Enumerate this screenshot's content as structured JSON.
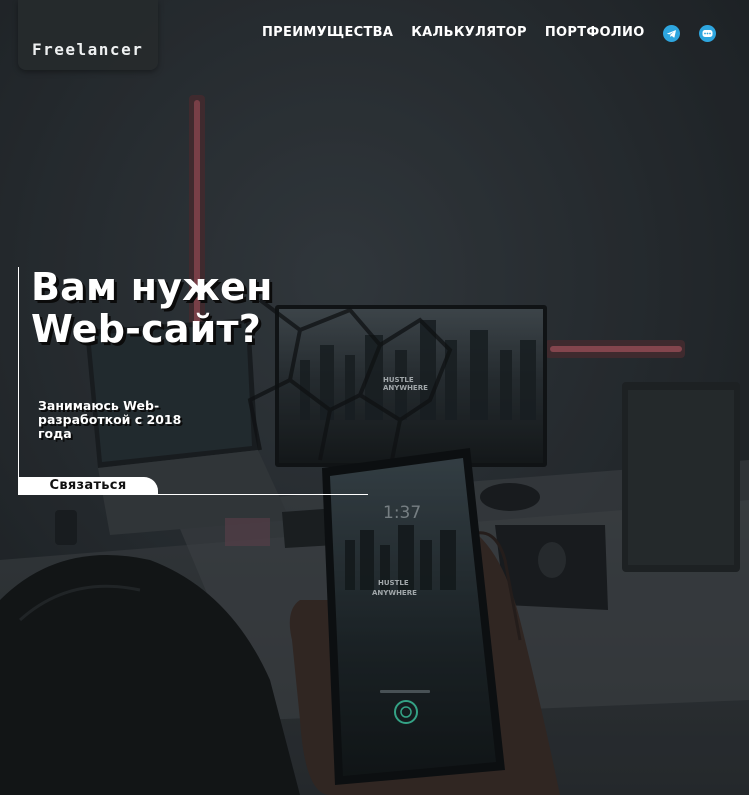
{
  "header": {
    "logo": "Freelancer",
    "nav": [
      {
        "label": "ПРЕИМУЩЕСТВА"
      },
      {
        "label": "КАЛЬКУЛЯТОР"
      },
      {
        "label": "ПОРТФОЛИО"
      }
    ],
    "social": [
      {
        "icon": "telegram-icon"
      },
      {
        "icon": "chat-icon"
      }
    ]
  },
  "hero": {
    "title": "Вам нужен Web-сайт?",
    "subtitle": "Занимаюсь Web-разработкой с 2018 года",
    "cta_label": "Связаться",
    "background": {
      "phone_text_time": "1:37",
      "poster_text": "HUSTLE ANYWHERE"
    }
  },
  "colors": {
    "overlay": "#1f2326",
    "accent_led": "#d15c6a",
    "social_blue": "#2ea6df",
    "text": "#ffffff"
  }
}
